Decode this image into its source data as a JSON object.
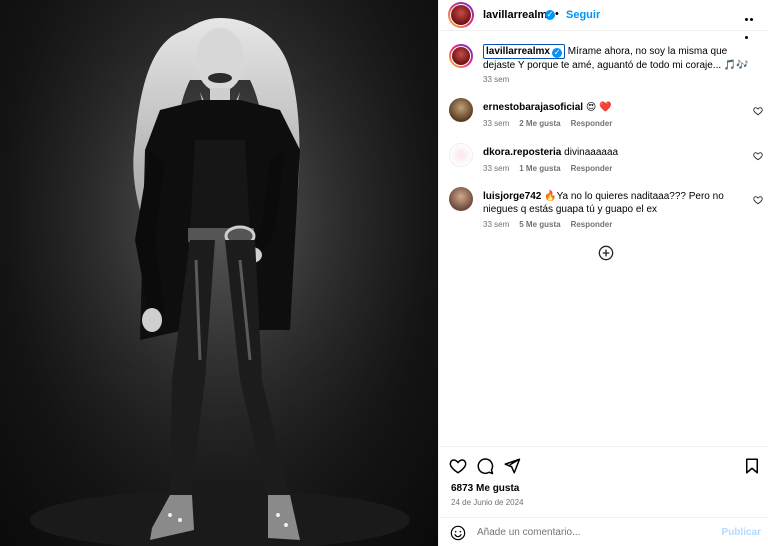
{
  "post": {
    "username": "lavillarrealmx",
    "follow_label": "Seguir",
    "caption_text": "Mírame ahora, no soy la misma que dejaste Y porque te amé, aguantó de todo mi coraje... 🎵🎶",
    "caption_time": "33 sem",
    "likes": "6873 Me gusta",
    "date": "24 de Junio de 2024"
  },
  "comments": [
    {
      "user": "ernestobarajasoficial",
      "text": "😍 ❤️",
      "time": "33 sem",
      "likes": "2 Me gusta",
      "reply": "Responder"
    },
    {
      "user": "dkora.reposteria",
      "text": "divinaaaaaa",
      "time": "33 sem",
      "likes": "1 Me gusta",
      "reply": "Responder"
    },
    {
      "user": "luisjorge742",
      "text": "🔥Ya no lo quieres naditaaa??? Pero no niegues q estás guapa tú y guapo el ex",
      "time": "33 sem",
      "likes": "5 Me gusta",
      "reply": "Responder"
    }
  ],
  "composer": {
    "placeholder": "Añade un comentario...",
    "publish_label": "Publicar"
  },
  "icons": {
    "like": "heart-icon",
    "comment": "comment-icon",
    "share": "share-icon",
    "save": "bookmark-icon",
    "more": "more-options-icon",
    "load_more": "plus-circle-icon",
    "emoji": "emoji-icon",
    "verified": "verified-badge-icon"
  },
  "colors": {
    "accent": "#0095f6",
    "muted": "#737373",
    "border": "#efefef"
  }
}
